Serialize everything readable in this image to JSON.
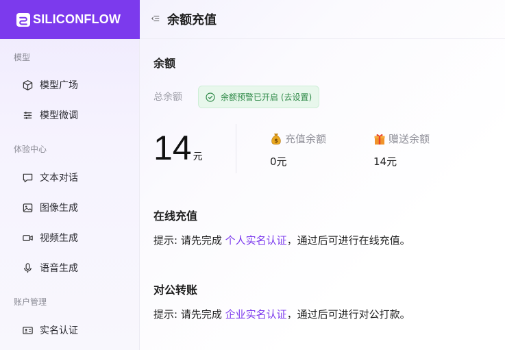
{
  "brand": {
    "name": "SILICONFLOW",
    "color": "#7c3aed"
  },
  "sidebar": {
    "groups": [
      {
        "label": "模型",
        "items": [
          {
            "label": "模型广场",
            "icon": "cube-icon"
          },
          {
            "label": "模型微调",
            "icon": "sliders-icon"
          }
        ]
      },
      {
        "label": "体验中心",
        "items": [
          {
            "label": "文本对话",
            "icon": "chat-bubble-icon"
          },
          {
            "label": "图像生成",
            "icon": "image-icon"
          },
          {
            "label": "视频生成",
            "icon": "video-icon"
          },
          {
            "label": "语音生成",
            "icon": "microphone-icon"
          }
        ]
      },
      {
        "label": "账户管理",
        "items": [
          {
            "label": "实名认证",
            "icon": "id-card-icon"
          }
        ]
      }
    ]
  },
  "header": {
    "title": "余额充值"
  },
  "balance": {
    "section_title": "余额",
    "total_label": "总余额",
    "alert_badge": "余额预警已开启 (去设置)",
    "total_value": "14",
    "unit": "元",
    "recharge": {
      "label": "充值余额",
      "value": "0元",
      "icon": "money-bag-icon"
    },
    "gift": {
      "label": "赠送余额",
      "value": "14元",
      "icon": "gift-icon"
    }
  },
  "online_recharge": {
    "title": "在线充值",
    "hint_prefix": "提示: 请先完成",
    "link": "个人实名认证",
    "hint_suffix": "，通过后可进行在线充值。"
  },
  "corporate_transfer": {
    "title": "对公转账",
    "hint_prefix": "提示: 请先完成",
    "link": "企业实名认证",
    "hint_suffix": "，通过后可进行对公打款。"
  },
  "colors": {
    "accent": "#7c3aed",
    "success": "#2f8a48",
    "success_bg": "#e8f7ec"
  }
}
